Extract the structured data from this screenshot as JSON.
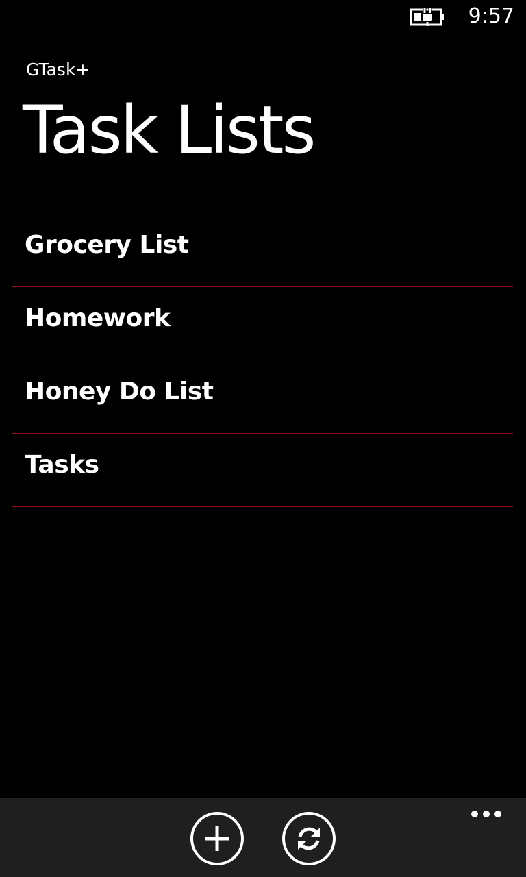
{
  "status_bar": {
    "battery_icon": "battery-charging-icon",
    "time": "9:57"
  },
  "header": {
    "app_title": "GTask+",
    "page_title": "Task Lists"
  },
  "task_lists": [
    {
      "label": "Grocery List"
    },
    {
      "label": "Homework"
    },
    {
      "label": "Honey Do List"
    },
    {
      "label": "Tasks"
    }
  ],
  "app_bar": {
    "buttons": [
      {
        "icon": "add-icon"
      },
      {
        "icon": "sync-icon"
      }
    ],
    "more_icon": "more-ellipsis-icon"
  },
  "colors": {
    "background": "#000000",
    "divider": "#8b0f14",
    "app_bar": "#1f1f1f",
    "text": "#ffffff"
  }
}
